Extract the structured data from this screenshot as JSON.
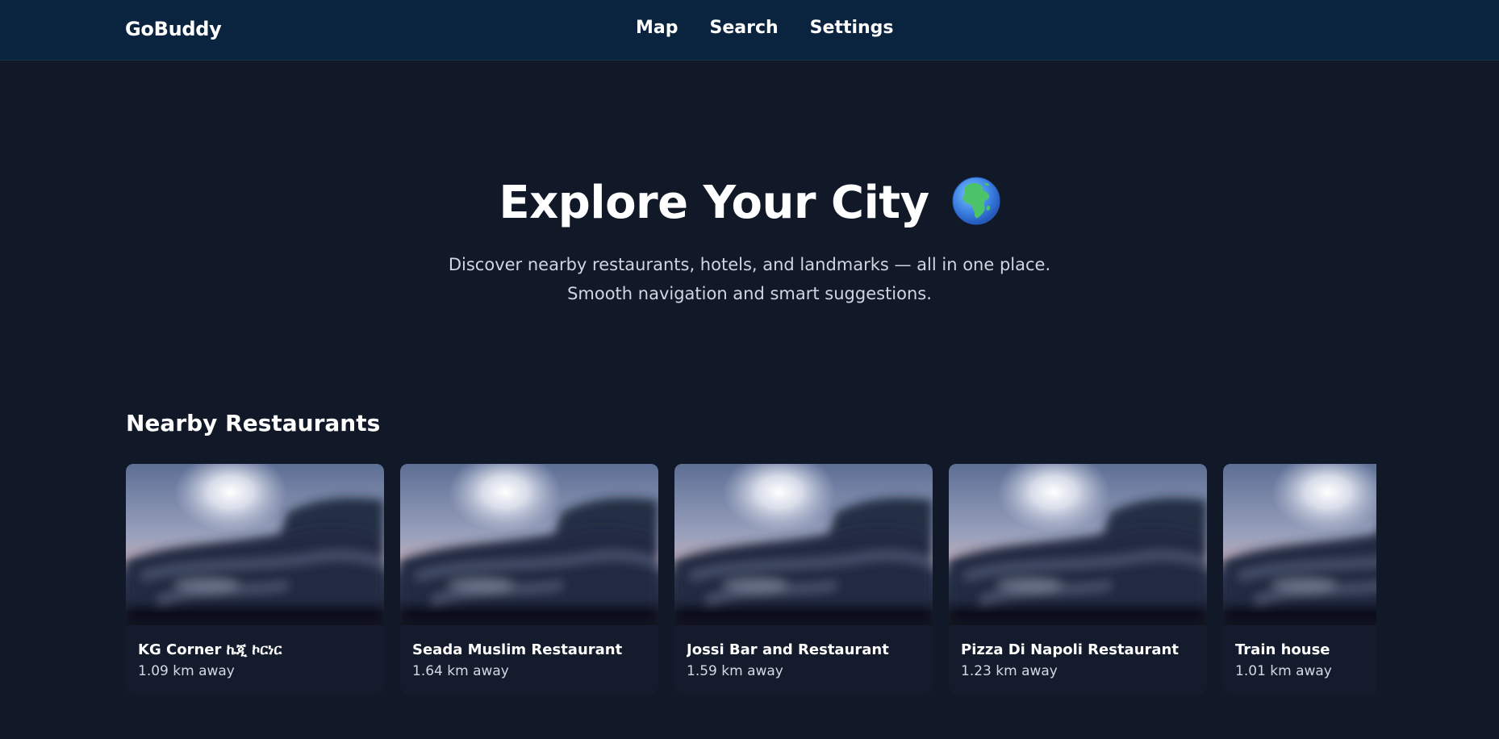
{
  "navbar": {
    "brand": "GoBuddy",
    "links": [
      {
        "label": "Map"
      },
      {
        "label": "Search"
      },
      {
        "label": "Settings"
      }
    ]
  },
  "hero": {
    "title": "Explore Your City",
    "icon": "globe-africa-icon",
    "subtitle": "Discover nearby restaurants, hotels, and landmarks — all in one place. Smooth navigation and smart suggestions."
  },
  "section": {
    "title": "Nearby Restaurants"
  },
  "restaurants": [
    {
      "name": "KG Corner ኬጂ ኮርነር",
      "distance": "1.09 km away"
    },
    {
      "name": "Seada Muslim Restaurant",
      "distance": "1.64 km away"
    },
    {
      "name": "Jossi Bar and Restaurant",
      "distance": "1.59 km away"
    },
    {
      "name": "Pizza Di Napoli Restaurant",
      "distance": "1.23 km away"
    },
    {
      "name": "Train house",
      "distance": "1.01 km away"
    }
  ],
  "colors": {
    "page_background": "#111827",
    "navbar_background": "#0a2440",
    "card_background": "#131b2c",
    "text_primary": "#ffffff",
    "text_secondary": "#cfd6e2"
  }
}
